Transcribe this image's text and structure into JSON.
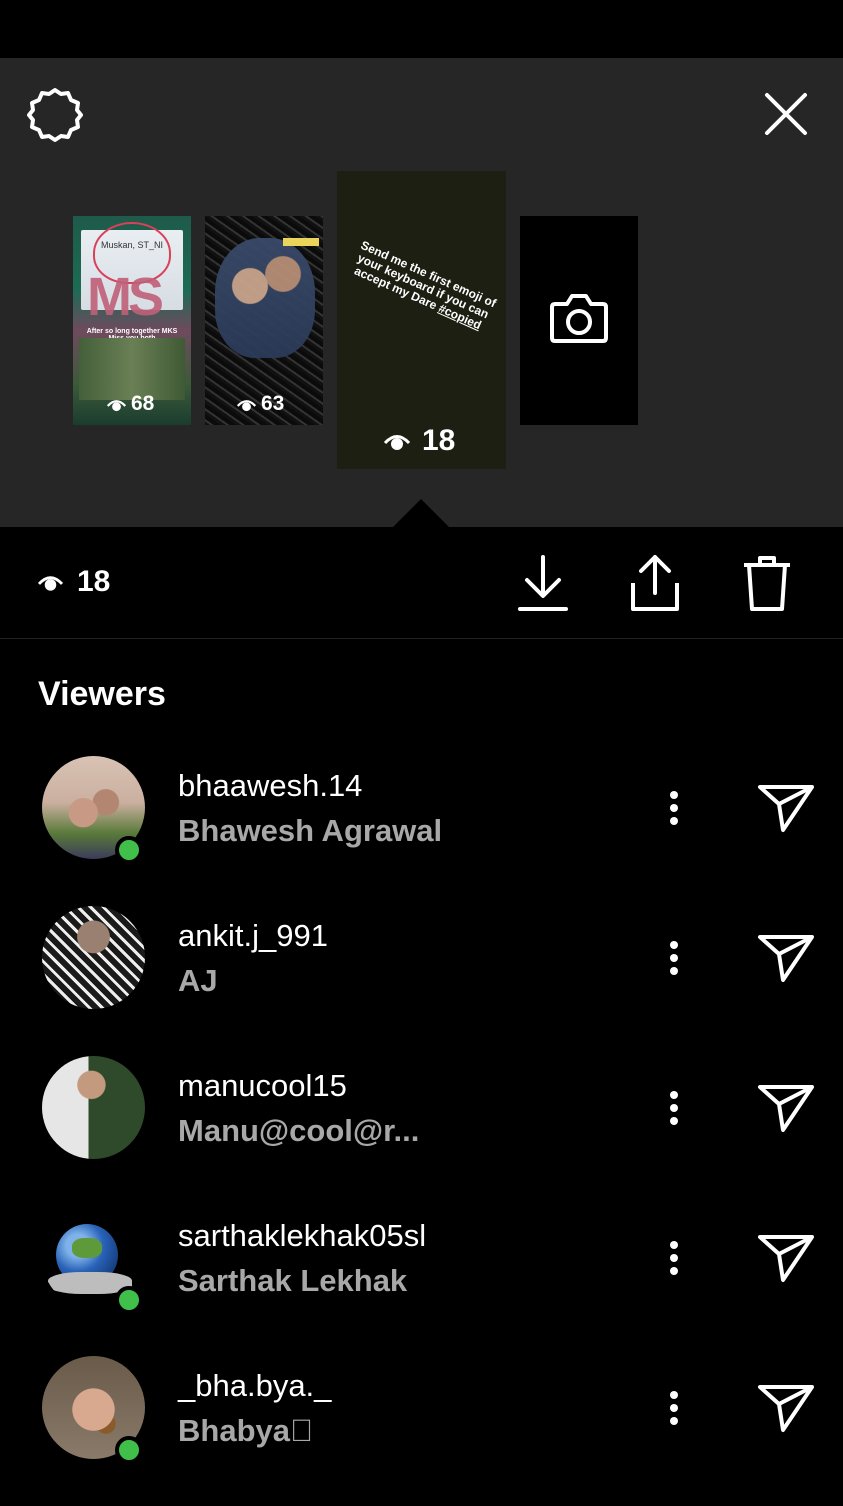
{
  "top_panel": {
    "stories": [
      {
        "chat_name": "Muskan, ST_NI",
        "caption": "After so long together MKS Miss you both",
        "views": "68"
      },
      {
        "views": "63"
      },
      {
        "text": "Send me the first emoji of your keyboard if you can accept my Dare",
        "hashtag": "#copied",
        "views": "18"
      }
    ]
  },
  "actions": {
    "total_views": "18"
  },
  "viewers": {
    "title": "Viewers",
    "list": [
      {
        "username": "bhaawesh.14",
        "fullname": "Bhawesh Agrawal",
        "online": true
      },
      {
        "username": "ankit.j_991",
        "fullname": "AJ",
        "online": false
      },
      {
        "username": "manucool15",
        "fullname": "Manu@cool@r...",
        "online": false
      },
      {
        "username": "sarthaklekhak05sl",
        "fullname": "Sarthak Lekhak",
        "online": true
      },
      {
        "username": "_bha.bya._",
        "fullname": "Bhabya\u0000",
        "online": true
      }
    ]
  },
  "colors": {
    "background": "#000000",
    "panel": "#262626",
    "online": "#40c04a",
    "secondary_text": "#a8a8a8"
  }
}
